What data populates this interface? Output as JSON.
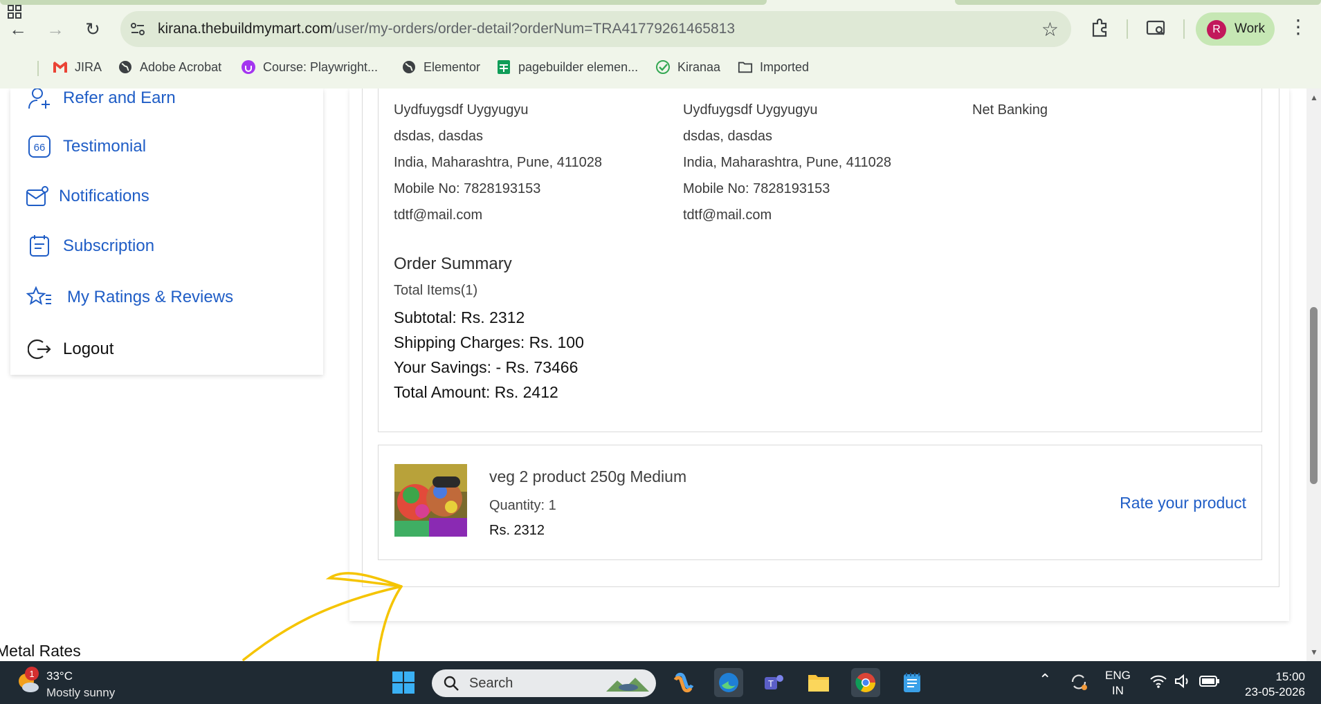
{
  "browser": {
    "url_host": "kirana.thebuildmymart.com",
    "url_path": "/user/my-orders/order-detail?orderNum=TRA41779261465813",
    "profile_initial": "R",
    "profile_label": "Work",
    "bookmarks": [
      {
        "label": "JIRA",
        "icon": "gmail-icon"
      },
      {
        "label": "Adobe Acrobat",
        "icon": "globe-icon"
      },
      {
        "label": "Course: Playwright...",
        "icon": "udemy-icon"
      },
      {
        "label": "Elementor",
        "icon": "globe-icon"
      },
      {
        "label": "pagebuilder elemen...",
        "icon": "sheets-icon"
      },
      {
        "label": "Kiranaa",
        "icon": "check-icon"
      },
      {
        "label": "Imported",
        "icon": "folder-icon"
      }
    ]
  },
  "sidebar": {
    "items": [
      {
        "label": "Refer and Earn",
        "icon": "refer-icon"
      },
      {
        "label": "Testimonial",
        "icon": "quote-icon"
      },
      {
        "label": "Notifications",
        "icon": "mail-icon"
      },
      {
        "label": "Subscription",
        "icon": "subscription-icon"
      },
      {
        "label": "My Ratings & Reviews",
        "icon": "star-list-icon"
      },
      {
        "label": "Logout",
        "icon": "logout-icon"
      }
    ]
  },
  "order": {
    "billing": {
      "name": "Uydfuygsdf Uygyugyu",
      "line1": "dsdas, dasdas",
      "line2": "India, Maharashtra, Pune, 411028",
      "mobile": "Mobile No: 7828193153",
      "email": "tdtf@mail.com"
    },
    "shipping": {
      "name": "Uydfuygsdf Uygyugyu",
      "line1": "dsdas, dasdas",
      "line2": "India, Maharashtra, Pune, 411028",
      "mobile": "Mobile No: 7828193153",
      "email": "tdtf@mail.com"
    },
    "payment_method": "Net Banking",
    "summary": {
      "title": "Order Summary",
      "total_items": "Total Items(1)",
      "subtotal": "Subtotal: Rs. 2312",
      "shipping": "Shipping Charges: Rs. 100",
      "savings": "Your Savings: - Rs. 73466",
      "total": "Total Amount: Rs. 2412"
    },
    "product": {
      "name": "veg 2 product 250g Medium",
      "quantity": "Quantity: 1",
      "price": "Rs. 2312",
      "rate_label": "Rate your product"
    }
  },
  "footer_peek": "Metal Rates",
  "taskbar": {
    "weather_badge": "1",
    "temperature": "33°C",
    "condition": "Mostly sunny",
    "search_label": "Search",
    "language": "ENG",
    "region": "IN",
    "time": "15:00",
    "date": "23-05-2026"
  },
  "colors": {
    "link_blue": "#1f5dc6",
    "chrome_bg": "#f0f5ea",
    "annotation_arrow": "#f5c400"
  }
}
